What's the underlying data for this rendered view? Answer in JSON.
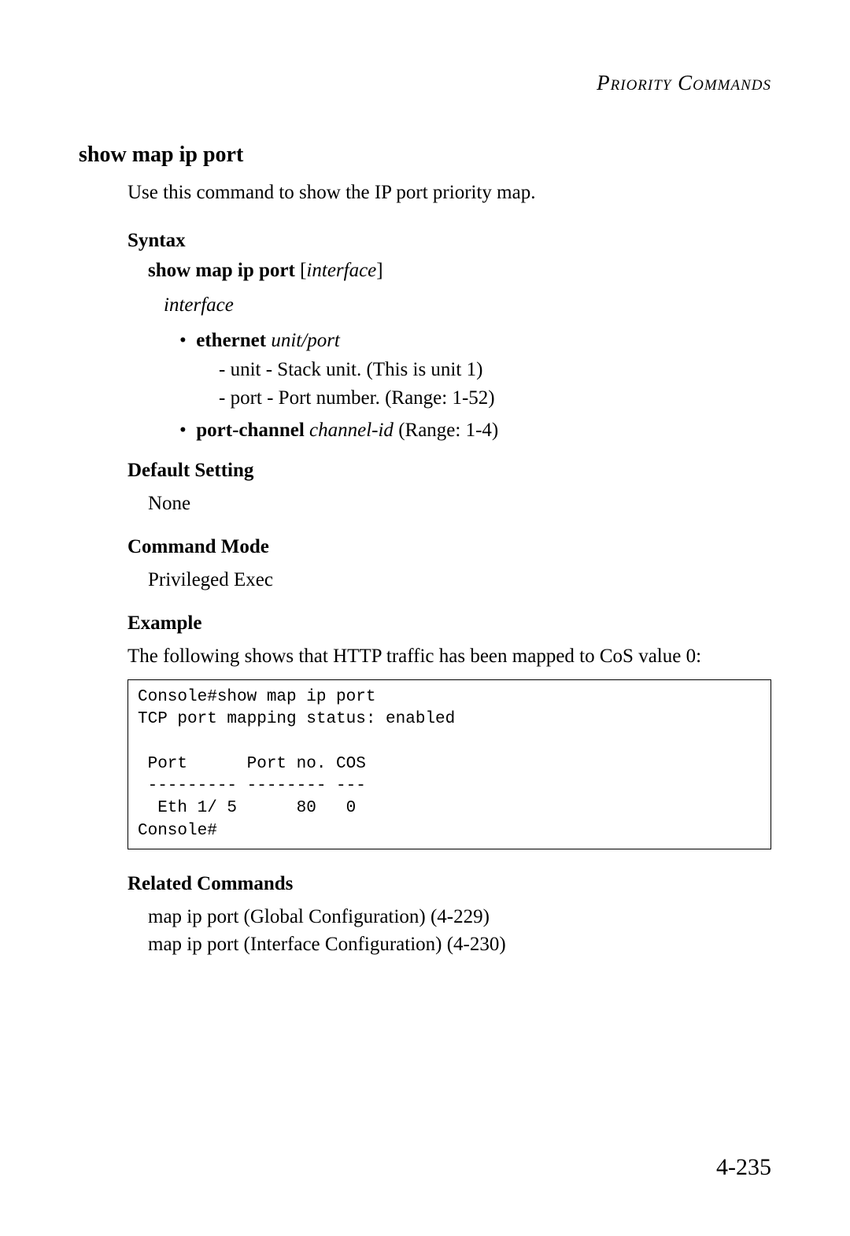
{
  "header": {
    "chapter_title": "Priority Commands"
  },
  "command": {
    "title": "show map ip port",
    "intro": "Use this command to show the IP port priority map."
  },
  "syntax": {
    "heading": "Syntax",
    "command_bold": "show map ip port",
    "command_param": "interface",
    "interface_label": "interface",
    "ethernet": {
      "bold": "ethernet",
      "italic": "unit/port",
      "unit_line": "-  unit - Stack unit. (This is unit 1)",
      "port_line": "-  port - Port number. (Range: 1-52)"
    },
    "port_channel": {
      "bold": "port-channel",
      "italic": "channel-id",
      "rest": " (Range: 1-4)"
    }
  },
  "default_setting": {
    "heading": "Default Setting",
    "value": "None"
  },
  "command_mode": {
    "heading": "Command Mode",
    "value": "Privileged Exec"
  },
  "example": {
    "heading": "Example",
    "description": "The following shows that  HTTP traffic has been mapped  to CoS value 0:",
    "code": "Console#show map ip port\nTCP port mapping status: enabled\n\n Port      Port no. COS\n --------- -------- ---\n  Eth 1/ 5      80   0\nConsole#"
  },
  "related": {
    "heading": "Related Commands",
    "items": [
      "map ip port (Global Configuration) (4-229)",
      "map ip port (Interface Configuration) (4-230)"
    ]
  },
  "page_number": "4-235"
}
